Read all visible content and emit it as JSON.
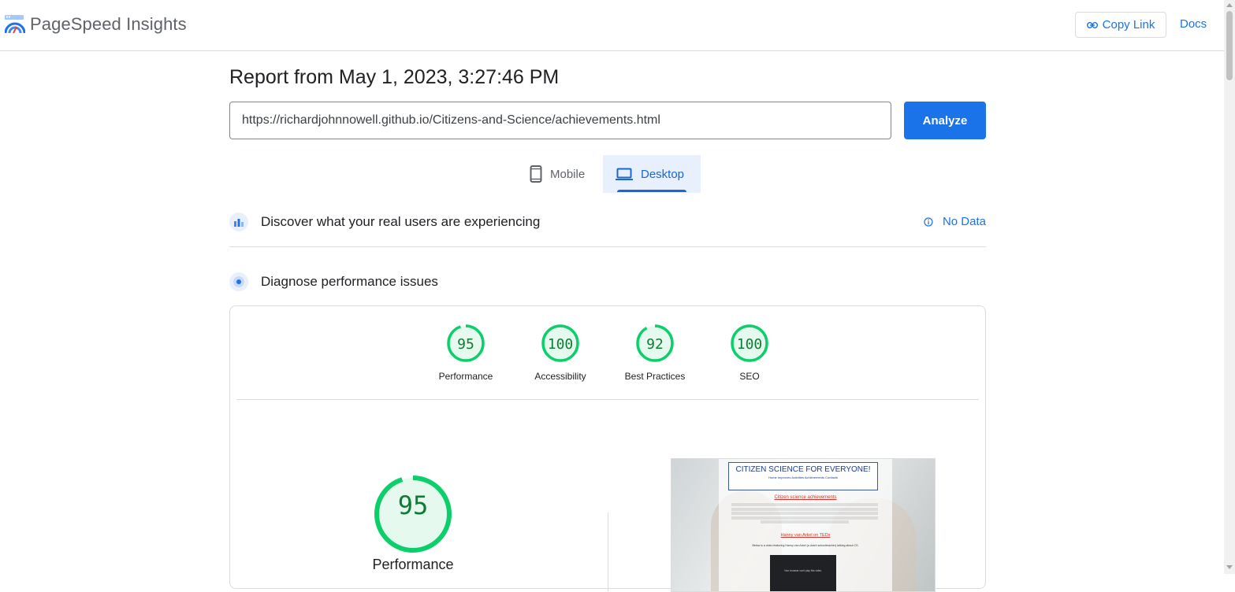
{
  "app": {
    "title": "PageSpeed Insights",
    "copy_link_label": "Copy Link",
    "docs_label": "Docs"
  },
  "report": {
    "title": "Report from May 1, 2023, 3:27:46 PM",
    "url_value": "https://richardjohnnowell.github.io/Citizens-and-Science/achievements.html",
    "analyze_label": "Analyze"
  },
  "tabs": [
    {
      "label": "Mobile",
      "icon": "phone-icon",
      "selected": false
    },
    {
      "label": "Desktop",
      "icon": "laptop-icon",
      "selected": true
    }
  ],
  "sections": {
    "discover": {
      "label": "Discover what your real users are experiencing",
      "status": "No Data"
    },
    "diagnose": {
      "label": "Diagnose performance issues"
    }
  },
  "scores": [
    {
      "label": "Performance",
      "value": "95"
    },
    {
      "label": "Accessibility",
      "value": "100"
    },
    {
      "label": "Best Practices",
      "value": "92"
    },
    {
      "label": "SEO",
      "value": "100"
    }
  ],
  "main_score": {
    "label": "Performance",
    "value": "95"
  },
  "screenshot": {
    "title": "CITIZEN SCIENCE FOR EVERYONE!",
    "nav": "Home  Improves  Activities  Achievements  Contacts",
    "subtitle": "Citizen science achievements",
    "link2": "Hanny van Arkel on TEDx",
    "line3": "Below is a video featuring Hanny van Arkel (a dutch schoolteacher) talking about CS.",
    "video_text": "Your browser can't play this video."
  },
  "colors": {
    "accent": "#1a73e8",
    "pass": "#0cce6b",
    "pass_text": "#0c7d33",
    "pass_bg": "#e6f9ee"
  }
}
